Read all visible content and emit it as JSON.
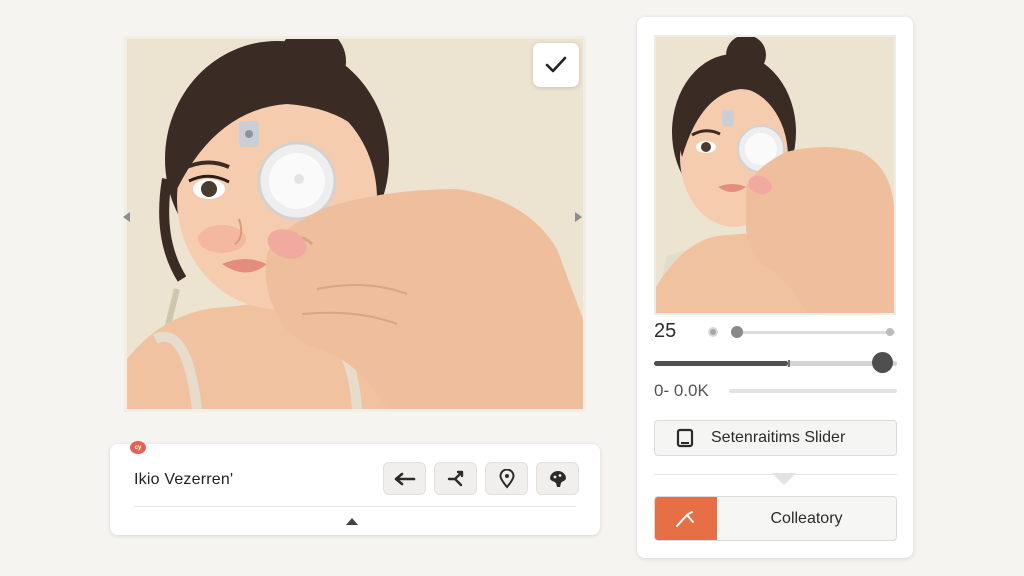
{
  "toolbar": {
    "badge": "cy",
    "title": "Ikio Vezerren'",
    "tools": [
      "arrow-left-icon",
      "split-arrows-icon",
      "location-pin-icon",
      "palette-icon"
    ]
  },
  "main_image": {
    "confirm_icon": "checkmark-icon",
    "prev_icon": "arrow-left-icon",
    "next_icon": "arrow-right-icon"
  },
  "panel": {
    "value_label": "25",
    "slider_a_value": 0.0,
    "slider_b_value": 0.94,
    "slider_b_mark": 0.55,
    "range_label": "0- 0.0K",
    "mode_label": "Setenraitims Slider",
    "mode_icon": "tablet-icon",
    "category_label": "Colleatory",
    "category_icon": "brush-icon"
  },
  "colors": {
    "accent": "#e66f45",
    "badge": "#e36256",
    "background": "#f6f4f0",
    "skin": "#f3c6a5",
    "hair": "#3a2b25"
  }
}
